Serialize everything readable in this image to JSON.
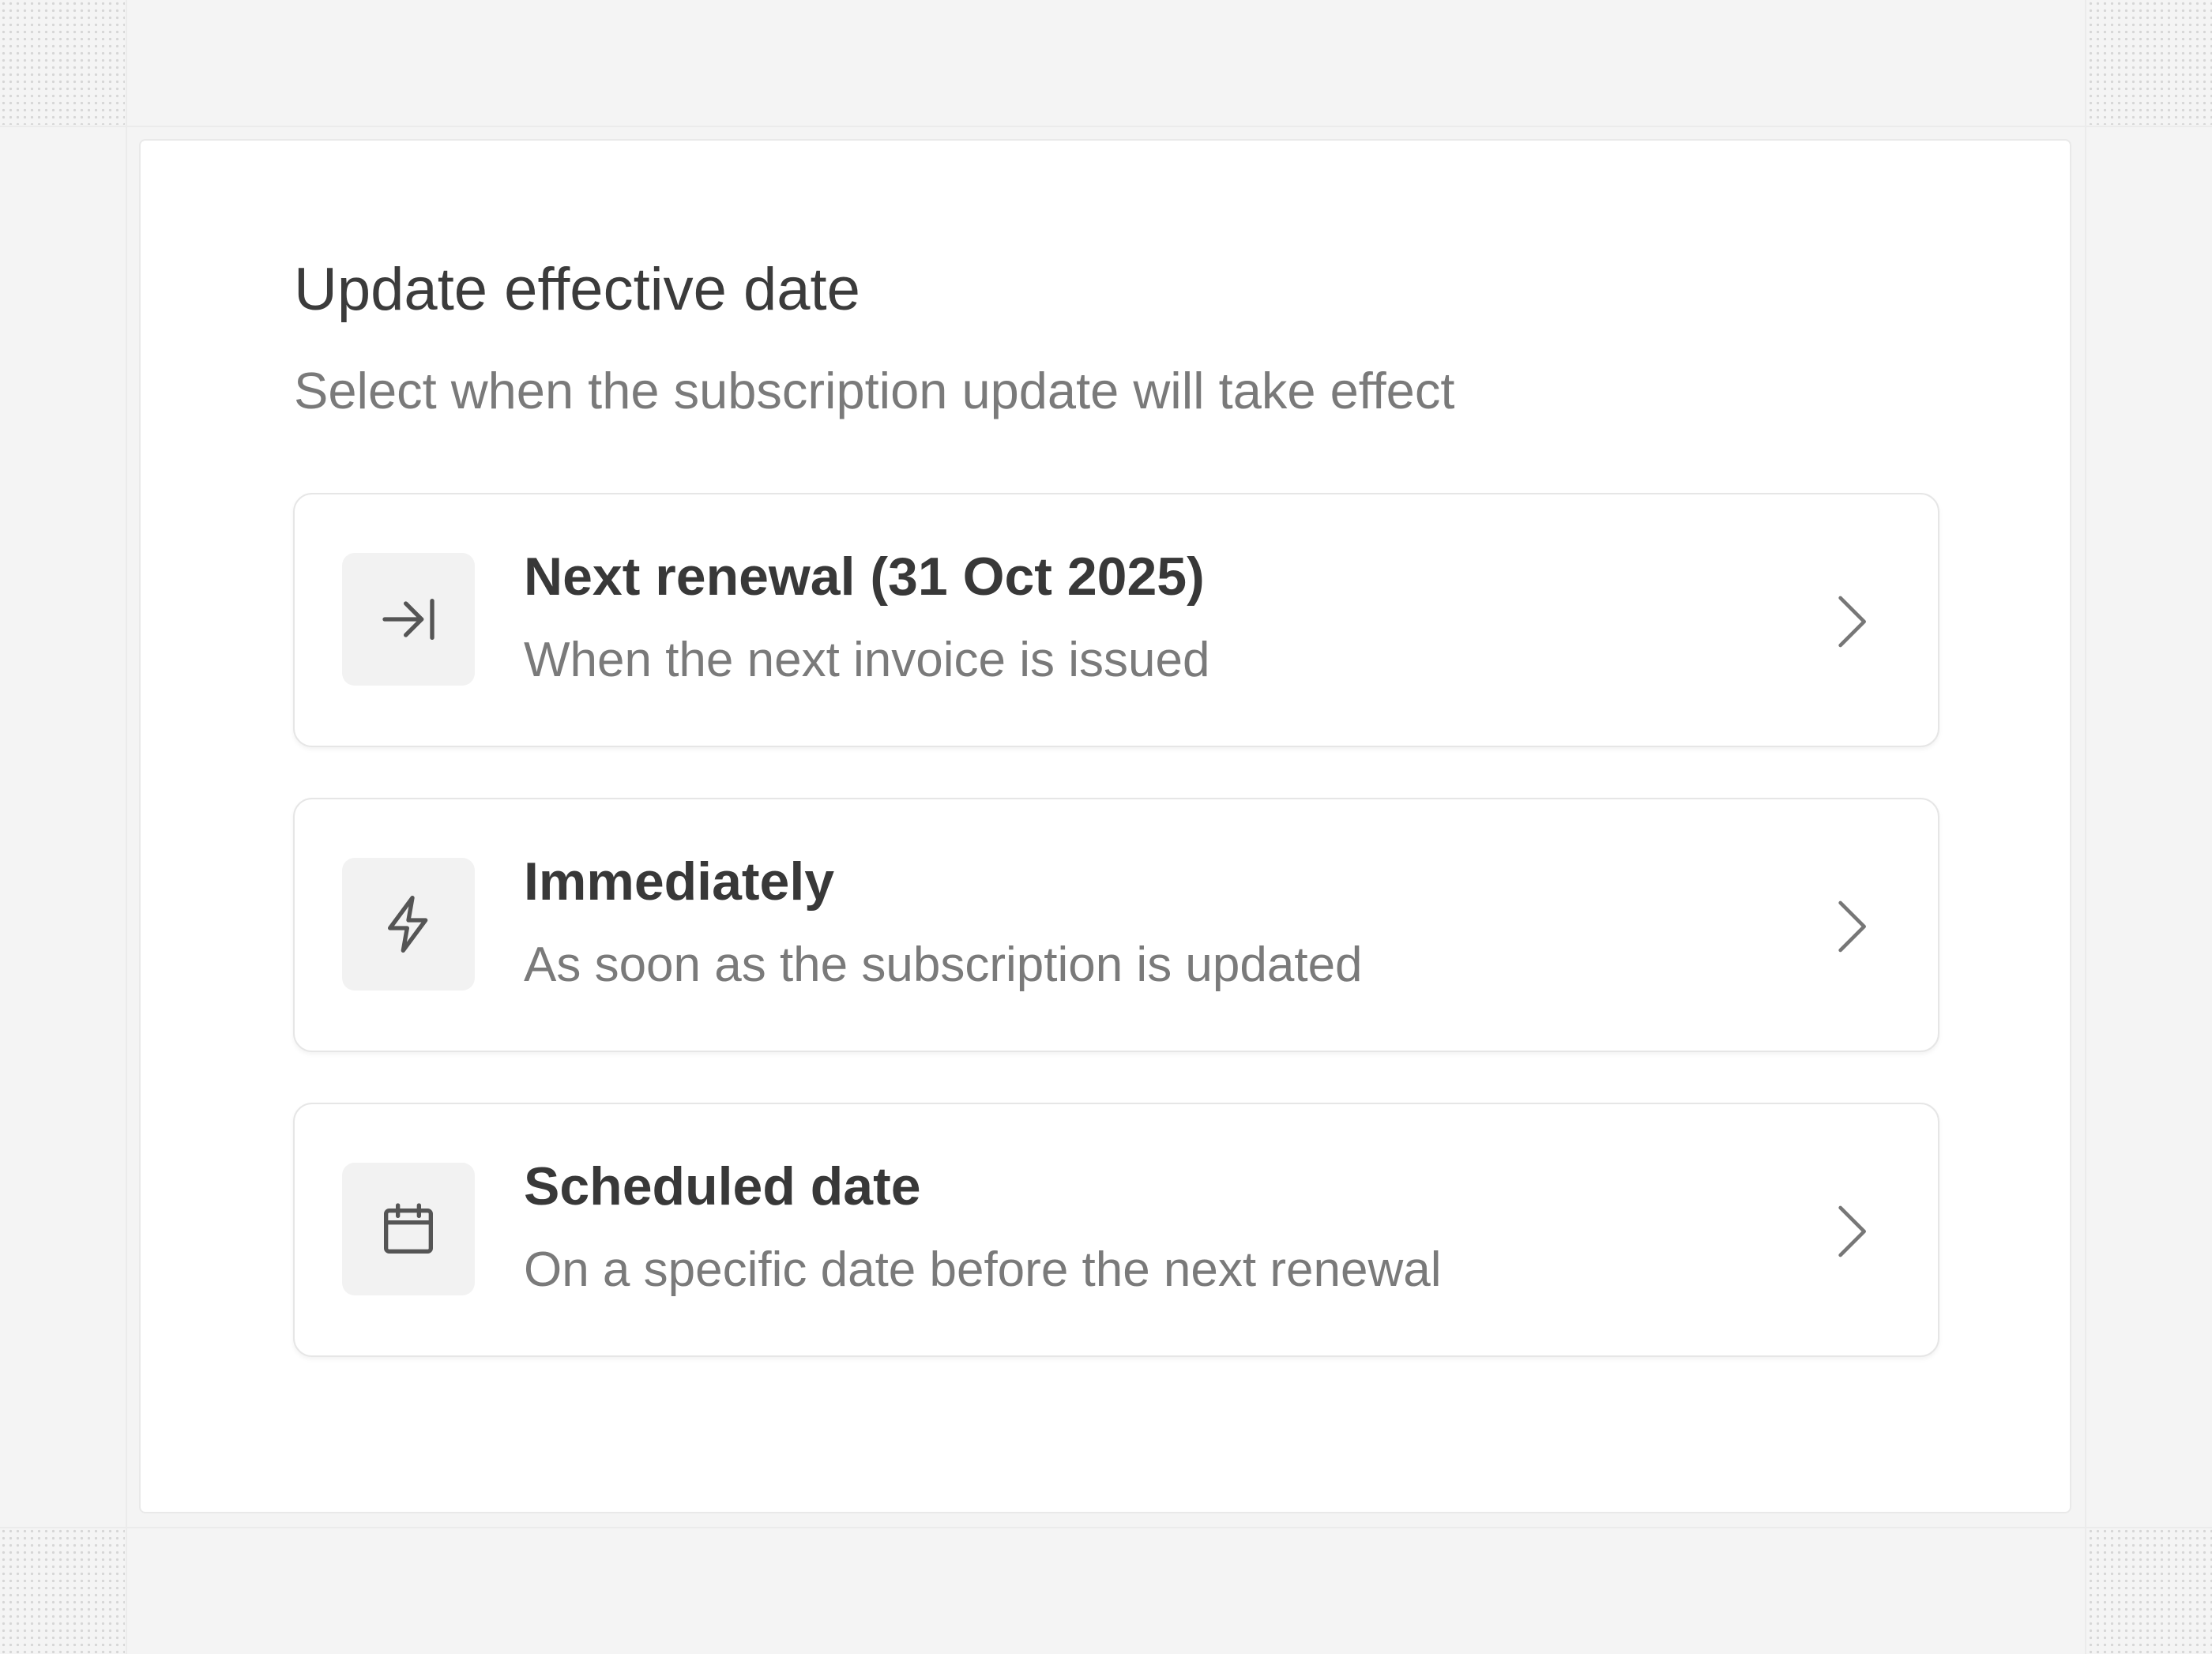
{
  "dialog": {
    "title": "Update effective date",
    "subtitle": "Select when the subscription update will take effect"
  },
  "options": [
    {
      "label": "Next renewal (31 Oct 2025)",
      "description": "When the next invoice is issued",
      "icon": "arrow-right-to-line-icon"
    },
    {
      "label": "Immediately",
      "description": "As soon as the subscription is updated",
      "icon": "lightning-bolt-icon"
    },
    {
      "label": "Scheduled date",
      "description": "On a specific date before the next renewal",
      "icon": "calendar-icon"
    }
  ],
  "colors": {
    "background": "#f4f4f4",
    "panel": "#ffffff",
    "title_text": "#3b3b3b",
    "secondary_text": "#7a7a7a",
    "icon_tile": "#f2f2f2",
    "icon_stroke": "#555555",
    "border": "#e6e6e6"
  }
}
